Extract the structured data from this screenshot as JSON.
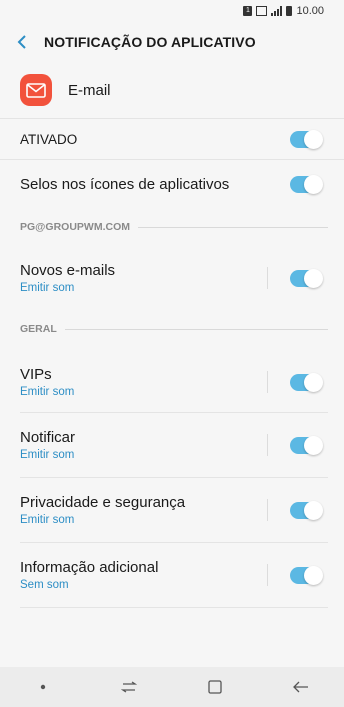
{
  "status": {
    "time": "10.00",
    "sim_label": "1"
  },
  "header": {
    "title": "NOTIFICAÇÃO DO APLICATIVO"
  },
  "app": {
    "name": "E-mail",
    "icon": "envelope-icon",
    "icon_color": "#f2523c"
  },
  "accent": "#5bb8e3",
  "subtitle_color": "#2d8ec5",
  "rows": {
    "ativado": {
      "label": "ATIVADO",
      "enabled": true
    },
    "selos": {
      "label": "Selos nos ícones de aplicativos",
      "enabled": true
    }
  },
  "sections": {
    "account": "PG@GROUPWM.COM",
    "geral": "GERAL"
  },
  "items": {
    "novos": {
      "title": "Novos e-mails",
      "sub": "Emitir som",
      "enabled": true
    },
    "vips": {
      "title": "VIPs",
      "sub": "Emitir som",
      "enabled": true
    },
    "notificar": {
      "title": "Notificar",
      "sub": "Emitir som",
      "enabled": true
    },
    "privacidade": {
      "title": "Privacidade e segurança",
      "sub": "Emitir som",
      "enabled": true
    },
    "info": {
      "title": "Informação adicional",
      "sub": "Sem som",
      "enabled": true
    }
  },
  "navbar": {
    "icons": [
      "dot-icon",
      "recents-icon",
      "home-icon",
      "back-icon"
    ]
  }
}
